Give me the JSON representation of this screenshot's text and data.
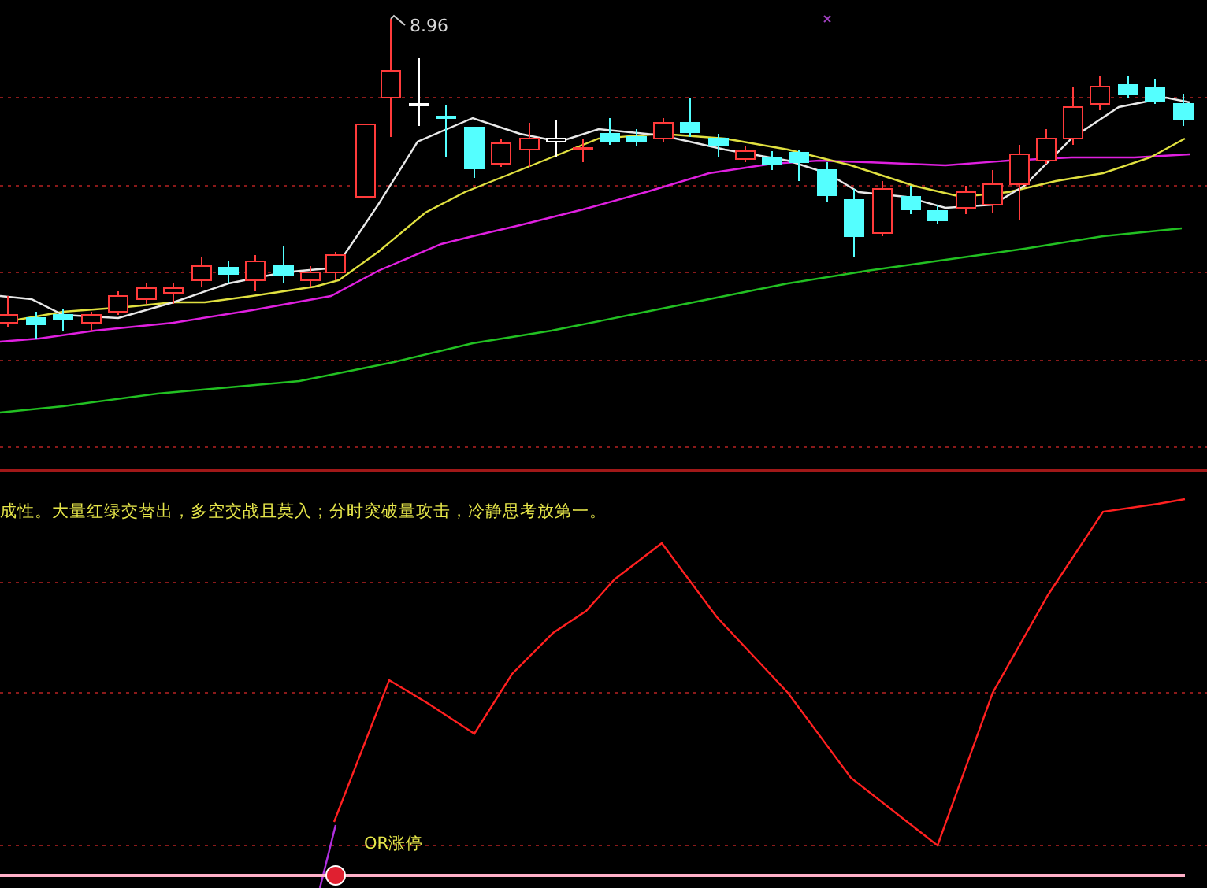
{
  "price_panel": {
    "high_label": "8.96"
  },
  "indicator_panel": {
    "commentary": "成性。大量红绿交替出，多空交战且莫入；分时突破量攻击，冷静思考放第一。",
    "signal_label": "OR涨停"
  }
}
